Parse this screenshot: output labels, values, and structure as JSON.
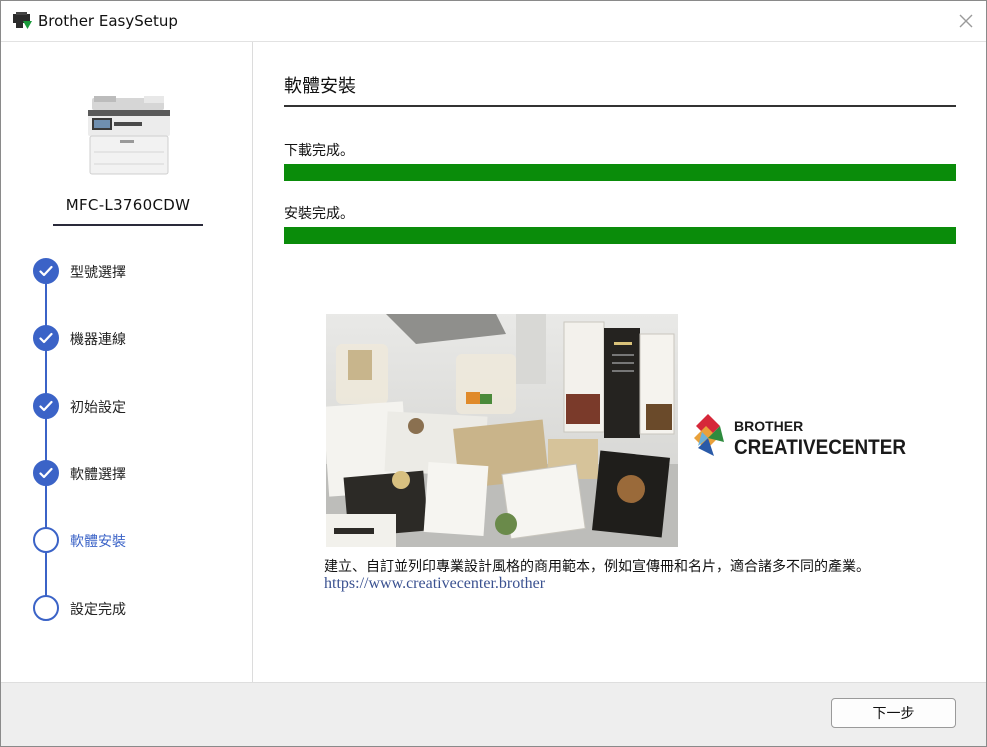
{
  "window": {
    "title": "Brother EasySetup"
  },
  "sidebar": {
    "model": "MFC-L3760CDW",
    "steps": [
      {
        "label": "型號選擇",
        "status": "done"
      },
      {
        "label": "機器連線",
        "status": "done"
      },
      {
        "label": "初始設定",
        "status": "done"
      },
      {
        "label": "軟體選擇",
        "status": "done"
      },
      {
        "label": "軟體安裝",
        "status": "active"
      },
      {
        "label": "設定完成",
        "status": "pending"
      }
    ]
  },
  "main": {
    "title": "軟體安裝",
    "progress": [
      {
        "label": "下載完成。",
        "percent": 100
      },
      {
        "label": "安裝完成。",
        "percent": 100
      }
    ],
    "promo": {
      "logo_line1": "BROTHER",
      "logo_line2": "CREATIVECENTER",
      "description": "建立、自訂並列印專業設計風格的商用範本，例如宣傳冊和名片，適合諸多不同的產業。",
      "link": "https://www.creativecenter.brother"
    }
  },
  "footer": {
    "next_label": "下一步"
  },
  "colors": {
    "accent": "#3b63c7",
    "progress": "#0a8c0a",
    "link": "#3a5190"
  }
}
